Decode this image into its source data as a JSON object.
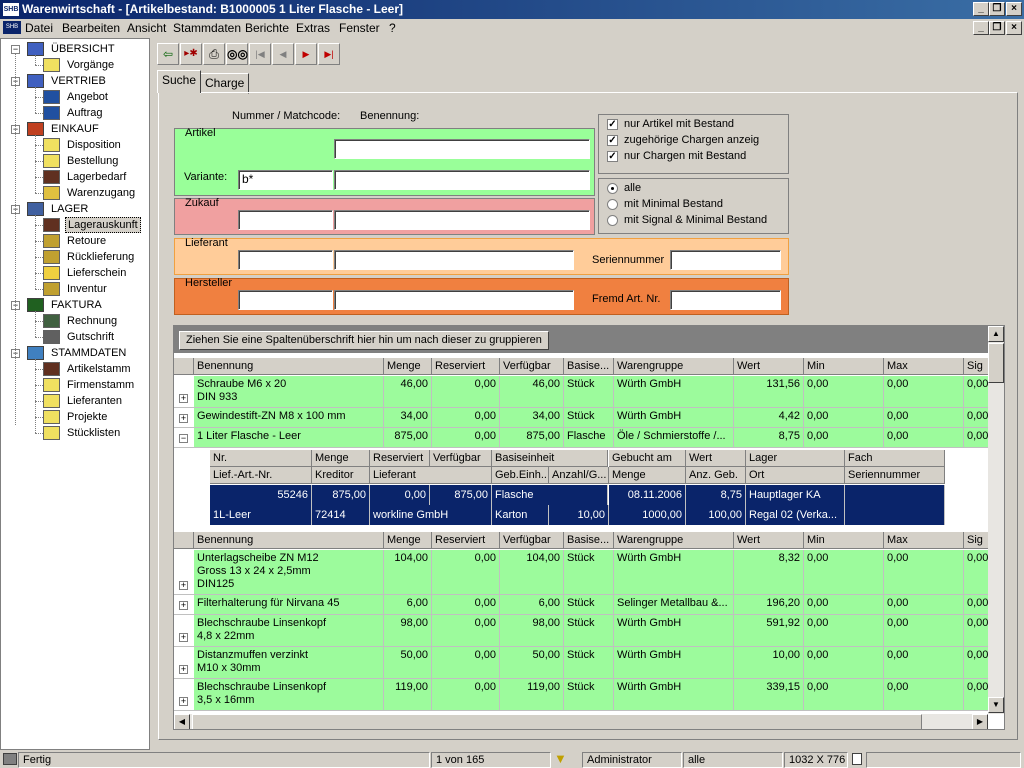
{
  "window": {
    "icon_text": "SHB",
    "title": "Warenwirtschaft - [Artikelbestand: B1000005  1 Liter Flasche - Leer]"
  },
  "menu": {
    "items": [
      "Datei",
      "Bearbeiten",
      "Ansicht",
      "Stammdaten",
      "Berichte",
      "Extras",
      "Fenster",
      "?"
    ]
  },
  "nav": {
    "groups": [
      {
        "label": "ÜBERSICHT",
        "icon": "overview-icon",
        "items": [
          {
            "label": "Vorgänge",
            "icon": "document-icon"
          }
        ]
      },
      {
        "label": "VERTRIEB",
        "icon": "sales-icon",
        "items": [
          {
            "label": "Angebot",
            "icon": "offer-icon"
          },
          {
            "label": "Auftrag",
            "icon": "order-icon"
          }
        ]
      },
      {
        "label": "EINKAUF",
        "icon": "purchase-icon",
        "items": [
          {
            "label": "Disposition",
            "icon": "document-icon"
          },
          {
            "label": "Bestellung",
            "icon": "document-icon"
          },
          {
            "label": "Lagerbedarf",
            "icon": "worker-icon"
          },
          {
            "label": "Warenzugang",
            "icon": "goods-in-icon"
          }
        ]
      },
      {
        "label": "LAGER",
        "icon": "forklift-icon",
        "items": [
          {
            "label": "Lagerauskunft",
            "icon": "worker-icon"
          },
          {
            "label": "Retoure",
            "icon": "return-icon"
          },
          {
            "label": "Rücklieferung",
            "icon": "return-icon"
          },
          {
            "label": "Lieferschein",
            "icon": "delivery-icon"
          },
          {
            "label": "Inventur",
            "icon": "inventory-icon"
          }
        ]
      },
      {
        "label": "FAKTURA",
        "icon": "invoice-icon",
        "items": [
          {
            "label": "Rechnung",
            "icon": "calculator-icon"
          },
          {
            "label": "Gutschrift",
            "icon": "credit-icon"
          }
        ]
      },
      {
        "label": "STAMMDATEN",
        "icon": "masterdata-icon",
        "items": [
          {
            "label": "Artikelstamm",
            "icon": "worker-icon"
          },
          {
            "label": "Firmenstamm",
            "icon": "document-icon"
          },
          {
            "label": "Lieferanten",
            "icon": "document-icon"
          },
          {
            "label": "Projekte",
            "icon": "document-icon"
          },
          {
            "label": "Stücklisten",
            "icon": "document-icon"
          }
        ]
      }
    ],
    "selected": "Lagerauskunft"
  },
  "tabs": [
    "Suche",
    "Charge"
  ],
  "search": {
    "col_labels": {
      "number": "Nummer / Matchcode:",
      "name": "Benennung:"
    },
    "artikel": {
      "title": "Artikel",
      "variante_label": "Variante:",
      "variante_value": "b*",
      "name_value": "",
      "variante_name_value": ""
    },
    "zukauf": {
      "title": "Zukauf",
      "value1": "",
      "value2": ""
    },
    "lieferant": {
      "title": "Lieferant",
      "serial_label": "Seriennummer",
      "value1": "",
      "value2": "",
      "serial_value": ""
    },
    "hersteller": {
      "title": "Hersteller",
      "fremd_label": "Fremd Art. Nr.",
      "value1": "",
      "value2": "",
      "fremd_value": ""
    },
    "checks": [
      {
        "label": "nur Artikel mit Bestand",
        "checked": true
      },
      {
        "label": "zugehörige Chargen anzeig",
        "checked": true
      },
      {
        "label": "nur Chargen mit Bestand",
        "checked": true
      }
    ],
    "radios": [
      {
        "label": "alle",
        "selected": true
      },
      {
        "label": "mit Minimal Bestand",
        "selected": false
      },
      {
        "label": "mit Signal & Minimal Bestand",
        "selected": false
      }
    ]
  },
  "grid": {
    "group_hint": "Ziehen Sie eine Spaltenüberschrift hier hin um nach dieser zu gruppieren",
    "columns": [
      "Benennung",
      "Menge",
      "Reserviert",
      "Verfügbar",
      "Basise...",
      "Warengruppe",
      "Wert",
      "Min",
      "Max",
      "Sig"
    ],
    "rows_top": [
      {
        "expander": "+",
        "cells": [
          "Schraube M6 x 20\nDIN 933",
          "46,00",
          "0,00",
          "46,00",
          "Stück",
          "Würth GmbH",
          "131,56",
          "0,00",
          "0,00",
          "0,00"
        ]
      },
      {
        "expander": "+",
        "cells": [
          "Gewindestift-ZN M8 x 100 mm",
          "34,00",
          "0,00",
          "34,00",
          "Stück",
          "Würth GmbH",
          "4,42",
          "0,00",
          "0,00",
          "0,00"
        ]
      },
      {
        "expander": "−",
        "cells": [
          "1 Liter Flasche - Leer",
          "875,00",
          "0,00",
          "875,00",
          "Flasche",
          "Öle / Schmierstoffe /...",
          "8,75",
          "0,00",
          "0,00",
          "0,00"
        ]
      }
    ],
    "detail": {
      "header1": [
        "Nr.",
        "Menge",
        "Reserviert",
        "Verfügbar",
        "Basiseinheit",
        "Gebucht am",
        "Wert",
        "Lager",
        "Fach"
      ],
      "header2": [
        "Lief.-Art.-Nr.",
        "Kreditor",
        "Lieferant",
        "Geb.Einh...",
        "Anzahl/G...",
        "Menge",
        "Anz. Geb.",
        "Ort",
        "Seriennummer"
      ],
      "row1": [
        "55246",
        "875,00",
        "0,00",
        "875,00",
        "Flasche",
        "08.11.2006",
        "8,75",
        "Hauptlager KA",
        ""
      ],
      "row2": [
        "1L-Leer",
        "72414",
        "workline GmbH",
        "Karton",
        "10,00",
        "1000,00",
        "100,00",
        "Regal 02 (Verka...",
        ""
      ]
    },
    "rows_bottom": [
      {
        "expander": "+",
        "cells": [
          "Unterlagscheibe ZN M12\nGross 13 x 24 x 2,5mm\nDIN125",
          "104,00",
          "0,00",
          "104,00",
          "Stück",
          "Würth GmbH",
          "8,32",
          "0,00",
          "0,00",
          "0,00"
        ]
      },
      {
        "expander": "+",
        "cells": [
          "Filterhalterung für Nirvana 45",
          "6,00",
          "0,00",
          "6,00",
          "Stück",
          "Selinger Metallbau &...",
          "196,20",
          "0,00",
          "0,00",
          "0,00"
        ]
      },
      {
        "expander": "+",
        "cells": [
          "Blechschraube Linsenkopf\n4,8 x 22mm",
          "98,00",
          "0,00",
          "98,00",
          "Stück",
          "Würth GmbH",
          "591,92",
          "0,00",
          "0,00",
          "0,00"
        ]
      },
      {
        "expander": "+",
        "cells": [
          "Distanzmuffen verzinkt\nM10 x 30mm",
          "50,00",
          "0,00",
          "50,00",
          "Stück",
          "Würth GmbH",
          "10,00",
          "0,00",
          "0,00",
          "0,00"
        ]
      },
      {
        "expander": "+",
        "cells": [
          "Blechschraube Linsenkopf\n3,5 x 16mm",
          "119,00",
          "0,00",
          "119,00",
          "Stück",
          "Würth GmbH",
          "339,15",
          "0,00",
          "0,00",
          "0,00"
        ]
      }
    ]
  },
  "status": {
    "state": "Fertig",
    "record": "1 von 165",
    "user": "Administrator",
    "filter": "alle",
    "resolution": "1032 X 776"
  },
  "colors": {
    "row_green": "#9cfb9c",
    "zukauf_red": "#f0a0a0",
    "lieferant_orange": "#ffcc99",
    "hersteller_orange": "#f08040",
    "artikel_green": "#99ff99",
    "selection_navy": "#0a246a"
  }
}
